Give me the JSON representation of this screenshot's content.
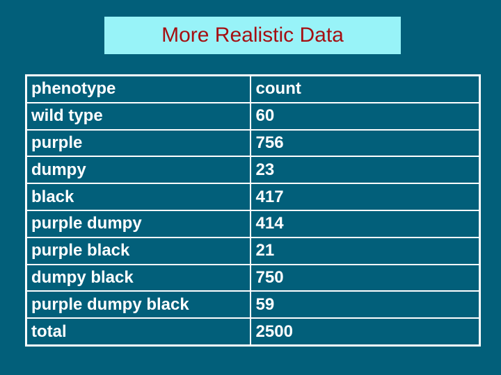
{
  "slide": {
    "title": "More Realistic Data",
    "colors": {
      "background": "#025f7a",
      "title_box": "#98f3f8",
      "title_text": "#a50f12",
      "table_text": "#ffffff",
      "table_border": "#ffffff"
    }
  },
  "table": {
    "header": {
      "phenotype": "phenotype",
      "count": "count"
    },
    "rows": [
      {
        "phenotype": "wild type",
        "count": "60"
      },
      {
        "phenotype": "purple",
        "count": "756"
      },
      {
        "phenotype": "dumpy",
        "count": "23"
      },
      {
        "phenotype": "black",
        "count": "417"
      },
      {
        "phenotype": "purple dumpy",
        "count": "414"
      },
      {
        "phenotype": "purple black",
        "count": "21"
      },
      {
        "phenotype": "dumpy black",
        "count": "750"
      },
      {
        "phenotype": "purple dumpy black",
        "count": "59"
      }
    ],
    "total": {
      "phenotype": "total",
      "count": "2500"
    }
  }
}
